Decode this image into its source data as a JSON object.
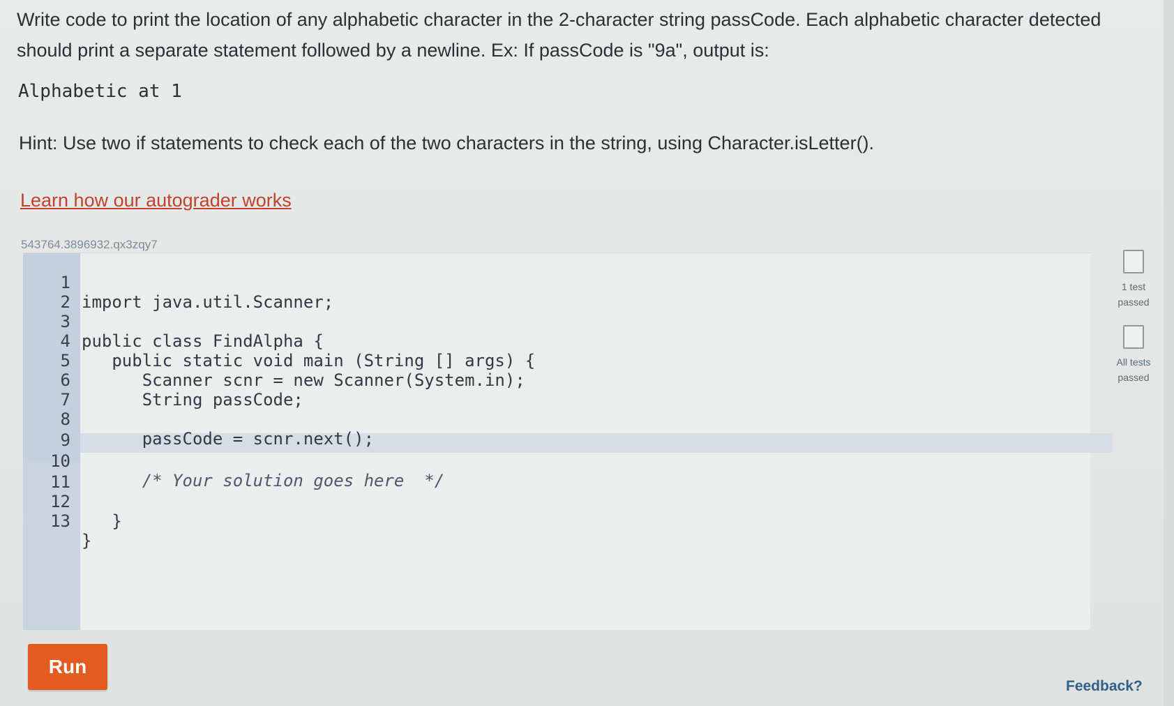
{
  "prompt": {
    "line1": "Write code to print the location of any alphabetic character in the 2-character string passCode. Each alphabetic character detected",
    "line2": "should print a separate statement followed by a newline. Ex: If passCode is \"9a\", output is:",
    "example_output": "Alphabetic at 1",
    "hint": "Hint: Use two if statements to check each of the two characters in the string, using Character.isLetter().",
    "link_text": "Learn how our autograder works"
  },
  "challenge_id": "543764.3896932.qx3zqy7",
  "editor": {
    "lines": [
      {
        "num": "1",
        "code": "import java.util.Scanner;"
      },
      {
        "num": "2",
        "code": ""
      },
      {
        "num": "3",
        "code": "public class FindAlpha {"
      },
      {
        "num": "4",
        "code": "   public static void main (String [] args) {"
      },
      {
        "num": "5",
        "code": "      Scanner scnr = new Scanner(System.in);"
      },
      {
        "num": "6",
        "code": "      String passCode;"
      },
      {
        "num": "7",
        "code": ""
      },
      {
        "num": "8",
        "code": "      passCode = scnr.next();"
      },
      {
        "num": "9",
        "code": ""
      },
      {
        "num": "10",
        "code": "      /* Your solution goes here  */"
      },
      {
        "num": "11",
        "code": ""
      },
      {
        "num": "12",
        "code": "   }"
      },
      {
        "num": "13",
        "code": "}"
      }
    ]
  },
  "tests": {
    "one_test": "1 test\npassed",
    "all_tests": "All tests\npassed"
  },
  "buttons": {
    "run": "Run",
    "feedback": "Feedback?"
  },
  "colors": {
    "run_button": "#e35b1f",
    "link": "#c2412e",
    "gutter": "#c9d4e0"
  }
}
